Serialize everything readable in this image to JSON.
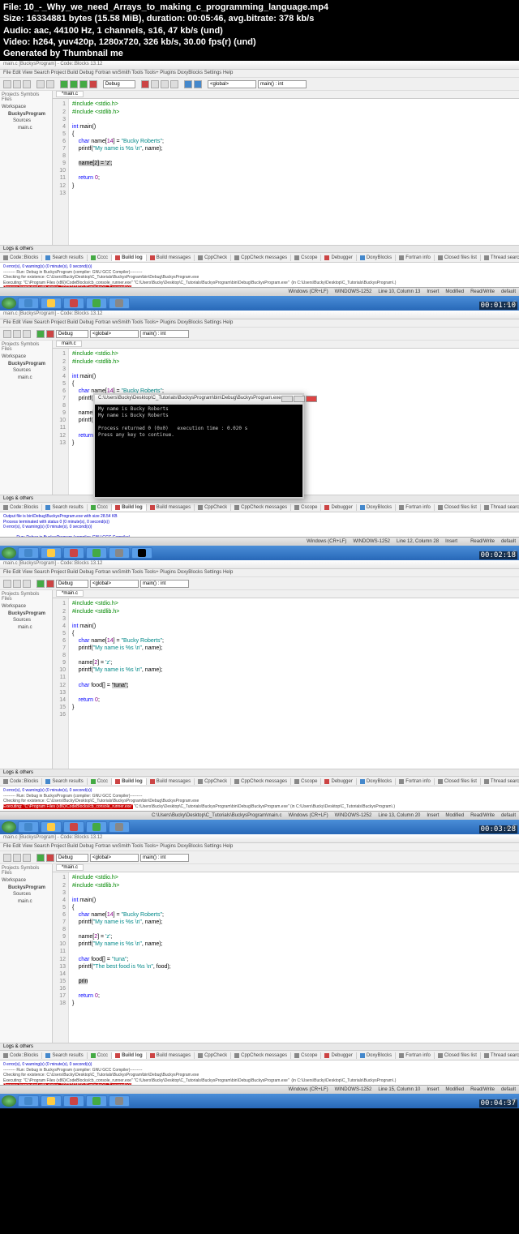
{
  "header": {
    "file": "File: 10_-_Why_we_need_Arrays_to_making_c_programming_language.mp4",
    "size": "Size: 16334881 bytes (15.58 MiB), duration: 00:05:46, avg.bitrate: 378 kb/s",
    "audio": "Audio: aac, 44100 Hz, 1 channels, s16, 47 kb/s (und)",
    "video": "Video: h264, yuv420p, 1280x720, 326 kb/s, 30.00 fps(r) (und)",
    "gen": "Generated by Thumbnail me"
  },
  "ide": {
    "title": "main.c [BuckysProgram] - Code::Blocks 13.12",
    "menu": "File  Edit  View  Search  Project  Build  Debug  Fortran  wxSmith  Tools  Tools+  Plugins  DoxyBlocks  Settings  Help",
    "dropdown1": "<global>",
    "dropdown2": "main() : int",
    "sidebar_tabs": "Projects  Symbols  Files",
    "workspace": "Workspace",
    "project": "BuckysProgram",
    "sources": "Sources",
    "file": "main.c",
    "tab": "*main.c",
    "logs_label": "Logs & others",
    "log_tabs": [
      "Code::Blocks",
      "Search results",
      "Cccc",
      "Build log",
      "Build messages",
      "CppCheck",
      "CppCheck messages",
      "Cscope",
      "Debugger",
      "DoxyBlocks",
      "Fortran info",
      "Closed files list",
      "Thread search"
    ],
    "status": {
      "enc": "Windows (CR+LF)",
      "cp": "WINDOWS-1252",
      "ins": "Insert",
      "mod": "Modified",
      "rw": "Read/Write"
    }
  },
  "frames": [
    {
      "timestamp": "00:01:10",
      "lines": [
        "1",
        "2",
        "3",
        "4",
        "5",
        "6",
        "7",
        "8",
        "9",
        "10",
        "11",
        "12",
        "13"
      ],
      "status_line": "Line 10, Column 13",
      "log": "--------- Run: Debug in BuckysProgram (compiler: GNU GCC Compiler)---------\nChecking for existence: C:\\Users\\Bucky\\Desktop\\C_Tutorials\\BuckysProgram\\bin\\Debug\\BuckysProgram.exe\nExecuting: \"C:\\Program Files (x86)\\CodeBlocks/cb_console_runner.exe\" \"C:\\Users\\Bucky\\Desktop\\C_Tutorials\\BuckysProgram\\bin\\Debug\\BuckysProgram.exe\"  (in C:\\Users\\Bucky\\Desktop\\C_Tutorials\\BuckysProgram\\.)",
      "summary": "0 error(s), 0 warning(s) (0 minute(s), 0 second(s))"
    },
    {
      "timestamp": "00:02:18",
      "lines": [
        "1",
        "2",
        "3",
        "4",
        "5",
        "6",
        "7",
        "8",
        "9",
        "10",
        "11",
        "12",
        "13"
      ],
      "status_line": "Line 12, Column 28",
      "status_mod": "Read/Write",
      "console_title": "C:\\Users\\Bucky\\Desktop\\C_Tutorials\\BuckysProgram\\bin\\Debug\\BuckysProgram.exe",
      "console_text": "My name is Bucky Roberts\nMy name is Bucky Roberts\n\nProcess returned 0 (0x0)   execution time : 0.020 s\nPress any key to continue.",
      "log": "Output file is bin\\Debug\\BuckysProgram.exe with size 28.54 KB\nProcess terminated with status 0 (0 minute(s), 0 second(s))\n0 error(s), 0 warning(s) (0 minute(s), 0 second(s))\n\n--------- Run: Debug in BuckysProgram (compiler: GNU GCC Compiler)---------\nChecking for existence: C:\\Users\\Bucky\\Desktop\\C_Tutorials\\BuckysProgram\\bin\\Debug\\BuckysProgram.exe\nExecuting: \"C:\\Program Files (x86)\\CodeBlocks/cb_console_runner.exe\" \"C:\\Users\\Bucky\\Desktop\\C_Tutorials\\BuckysProgram\\bin\\Debug\\BuckysProgram.exe\"  (in C:\\Users\\Bucky\\Desktop\\C_Tutorials\\BuckysProgram\\.)"
    },
    {
      "timestamp": "00:03:28",
      "lines": [
        "1",
        "2",
        "3",
        "4",
        "5",
        "6",
        "7",
        "8",
        "9",
        "10",
        "11",
        "12",
        "13",
        "14",
        "15",
        "16"
      ],
      "status_line": "Line 13, Column 20",
      "log": "--------- Run: Debug in BuckysProgram (compiler: GNU GCC Compiler)---------\nChecking for existence: C:\\Users\\Bucky\\Desktop\\C_Tutorials\\BuckysProgram\\bin\\Debug\\BuckysProgram.exe",
      "log_err": "Executing: \"C:\\Program Files (x86)\\CodeBlocks/cb_console_runner.exe\"",
      "log2": " \"C:\\Users\\Bucky\\Desktop\\C_Tutorials\\BuckysProgram\\bin\\Debug\\BuckysProgram.exe\"  (in C:\\Users\\Bucky\\Desktop\\C_Tutorials\\BuckysProgram\\.)",
      "summary": "0 error(s), 0 warning(s) (0 minute(s), 0 second(s))"
    },
    {
      "timestamp": "00:04:37",
      "lines": [
        "1",
        "2",
        "3",
        "4",
        "5",
        "6",
        "7",
        "8",
        "9",
        "10",
        "11",
        "12",
        "13",
        "14",
        "15",
        "16",
        "17",
        "18"
      ],
      "status_line": "Line 15, Column 10",
      "log": "--------- Run: Debug in BuckysProgram (compiler: GNU GCC Compiler)---------\nChecking for existence: C:\\Users\\Bucky\\Desktop\\C_Tutorials\\BuckysProgram\\bin\\Debug\\BuckysProgram.exe\nExecuting: \"C:\\Program Files (x86)\\CodeBlocks/cb_console_runner.exe\" \"C:\\Users\\Bucky\\Desktop\\C_Tutorials\\BuckysProgram\\bin\\Debug\\BuckysProgram.exe\"  (in C:\\Users\\Bucky\\Desktop\\C_Tutorials\\BuckysProgram\\.)",
      "summary": "0 error(s), 0 warning(s) (0 minute(s), 0 second(s))"
    }
  ],
  "code": {
    "inc1": "#include <stdio.h>",
    "inc2": "#include <stdlib.h>",
    "main": "int main()",
    "decl": "char name[14] = ",
    "name_str": "\"Bucky Roberts\"",
    "p1": "printf(",
    "p1s": "\"My name is %s \\n\"",
    "p1e": ", name);",
    "assign": "name[2] = ",
    "assign_v": "'z'",
    "highlight": "name[2] = 'z';",
    "p2s": "\"My name is %s \\n\"",
    "food_decl": "char food[] = ",
    "food_str": "\"tuna\"",
    "food_hl": "\"tuna\";",
    "pf": "printf(",
    "pfs": "\"The best food is %s \\n\"",
    "pfe": ", food);",
    "prin": "prin",
    "ret": "return 0;",
    "semi": ";"
  }
}
